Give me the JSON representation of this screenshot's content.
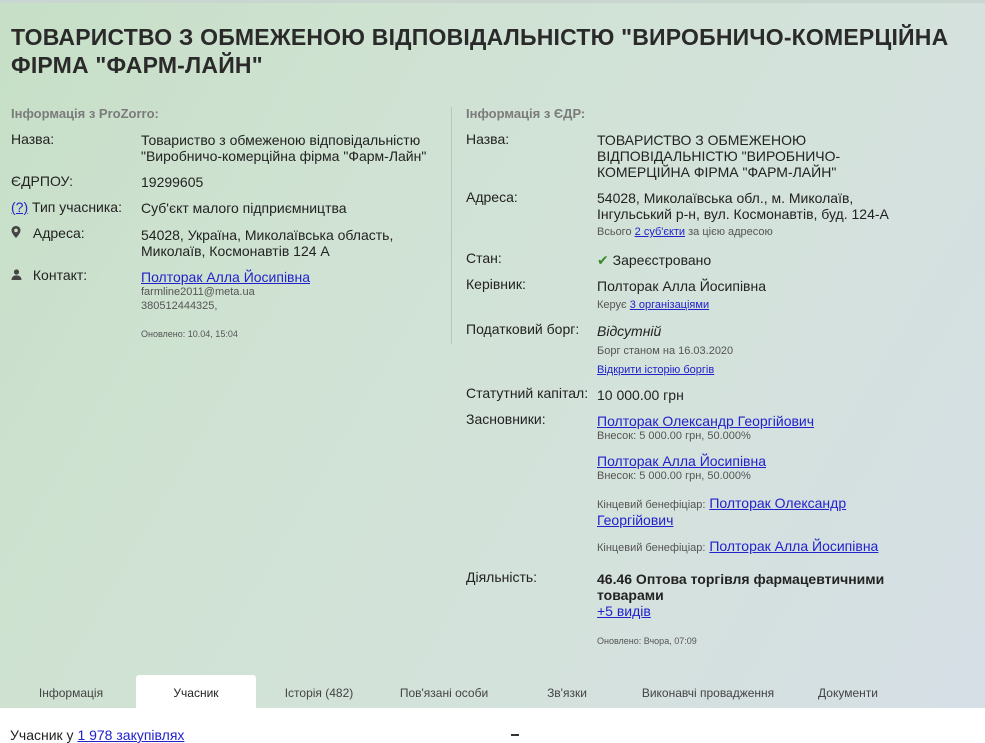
{
  "title": "ТОВАРИСТВО З ОБМЕЖЕНОЮ ВІДПОВІДАЛЬНІСТЮ \"ВИРОБНИЧО-КОМЕРЦІЙНА ФІРМА \"ФАРМ-ЛАЙН\"",
  "prozorro": {
    "heading": "Інформація з ProZorro:",
    "name_label": "Назва:",
    "name_line1": "Товариство з обмеженою відповідальністю",
    "name_line2": "\"Виробничо-комерційна фірма \"Фарм-Лайн\"",
    "edrpou_label": "ЄДРПОУ:",
    "edrpou_value": "19299605",
    "type_help": "(?)",
    "type_label": "Тип учасника:",
    "type_value": "Суб'єкт малого підприємництва",
    "address_label": "Адреса:",
    "address_line1": "54028, Україна, Миколаївська область,",
    "address_line2": "Миколаїв, Космонавтів 124 А",
    "contact_label": "Контакт:",
    "contact_name": "Полторак Алла Йосипівна",
    "contact_email": "farmline2011@meta.ua",
    "contact_phone": "380512444325,",
    "updated": "Оновлено: 10.04, 15:04"
  },
  "edr": {
    "heading": "Інформація з ЄДР:",
    "name_label": "Назва:",
    "name_line1": "ТОВАРИСТВО З ОБМЕЖЕНОЮ",
    "name_line2": "ВІДПОВІДАЛЬНІСТЮ \"ВИРОБНИЧО-",
    "name_line3": "КОМЕРЦІЙНА ФІРМА \"ФАРМ-ЛАЙН\"",
    "address_label": "Адреса:",
    "address_line1": "54028, Миколаївська обл., м. Миколаїв,",
    "address_line2": "Інгульський р-н, вул. Космонавтів, буд. 124-А",
    "address_note_pre": "Всього",
    "address_note_link": "2 суб'єкти",
    "address_note_post": "за цією адресою",
    "state_label": "Стан:",
    "state_value": "Зареєстровано",
    "head_label": "Керівник:",
    "head_value": "Полторак Алла Йосипівна",
    "head_note_pre": "Керує",
    "head_note_link": "3 організаціями",
    "debt_label": "Податковий борг:",
    "debt_value": "Відсутній",
    "debt_note": "Борг станом на 16.03.2020",
    "debt_history_link": "Відкрити історію боргів",
    "capital_label": "Статутний капітал:",
    "capital_value": "10 000.00 грн",
    "founders_label": "Засновники:",
    "founder1_name": "Полторак Олександр Георгійович",
    "founder1_share": "Внесок: 5 000.00 грн, 50.000%",
    "founder2_name": "Полторак Алла Йосипівна",
    "founder2_share": "Внесок: 5 000.00 грн, 50.000%",
    "beneficiary_label": "Кінцевий бенефіціар:",
    "beneficiary1_line1": "Полторак Олександр",
    "beneficiary1_line2": "Георгійович",
    "beneficiary2": "Полторак Алла Йосипівна",
    "activity_label": "Діяльність:",
    "activity_line1": "46.46 Оптова торгівля фармацевтичними",
    "activity_line2": "товарами",
    "activity_more": "+5 видів",
    "updated": "Оновлено: Вчора, 07:09"
  },
  "tabs": [
    {
      "label": "Інформація"
    },
    {
      "label": "Учасник"
    },
    {
      "label": "Історія (482)"
    },
    {
      "label": "Пов'язані особи"
    },
    {
      "label": "Зв'язки"
    },
    {
      "label": "Виконавчі провадження"
    },
    {
      "label": "Документи"
    }
  ],
  "active_tab": "Учасник",
  "bottom": {
    "text_pre": "Учасник у",
    "text_link": "1 978 закупівлях"
  },
  "colors": {
    "link": "#2222cc",
    "success": "#3a8a2a",
    "background_start": "#c6dfc6",
    "background_end": "#d6dfe6"
  },
  "icons": [
    "map-marker-icon",
    "user-icon",
    "check-icon"
  ]
}
